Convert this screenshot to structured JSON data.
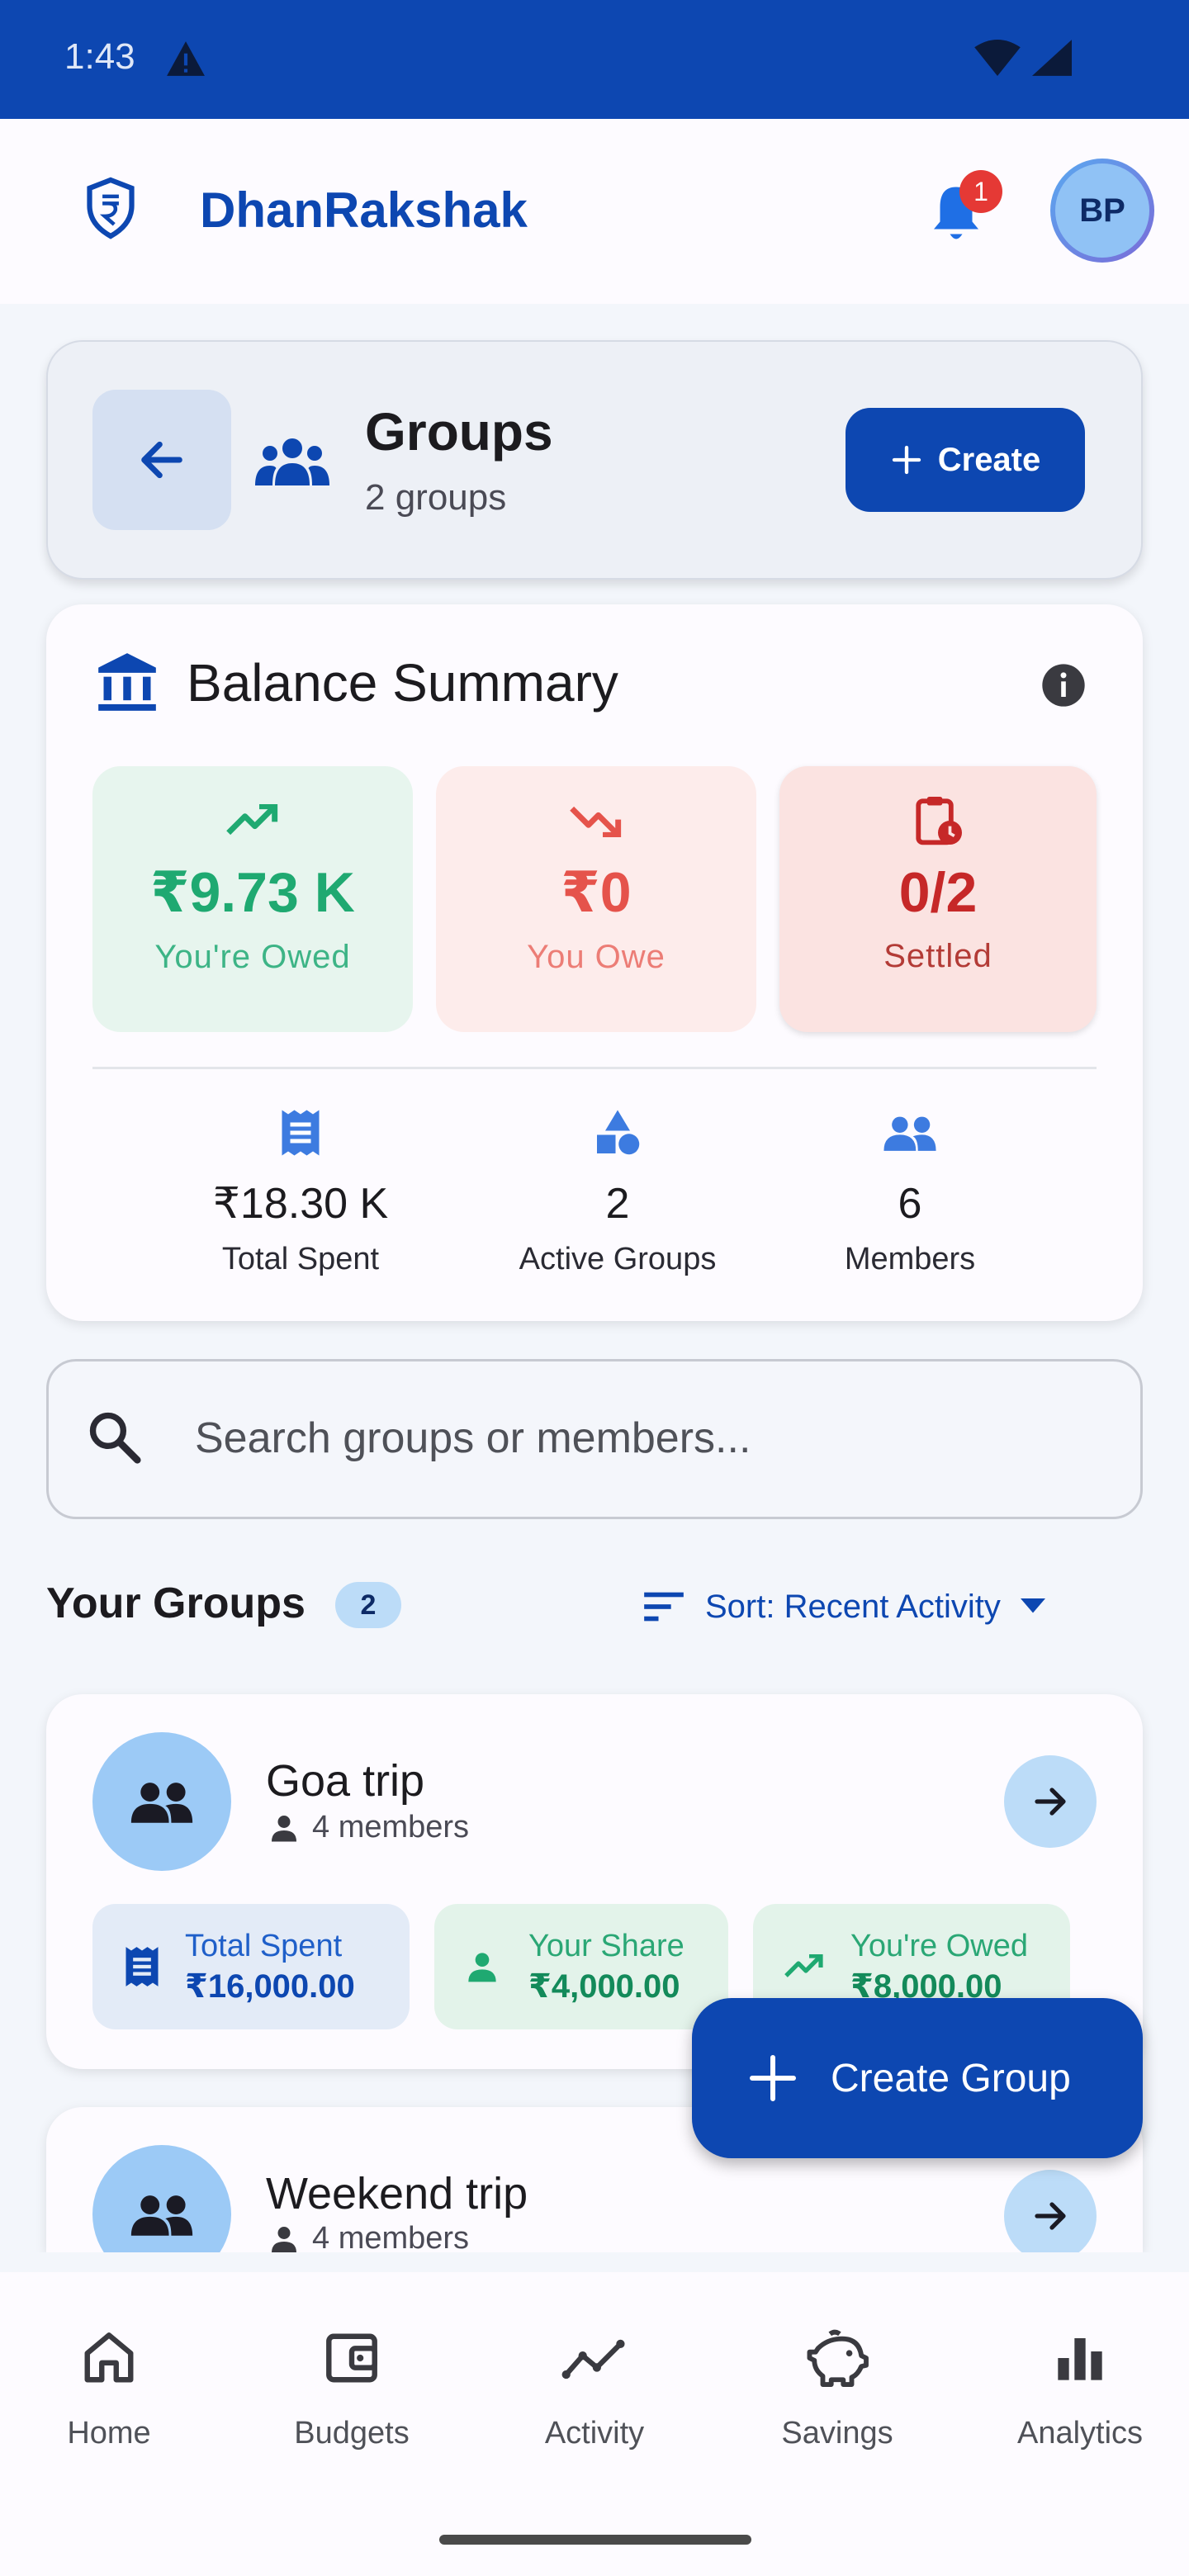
{
  "status_bar": {
    "time": "1:43"
  },
  "app_bar": {
    "title": "DhanRakshak",
    "notification_count": "1",
    "avatar_initials": "BP"
  },
  "header": {
    "title": "Groups",
    "subtitle": "2 groups",
    "create_label": "Create"
  },
  "balance_summary": {
    "title": "Balance Summary",
    "tiles": [
      {
        "value": "₹9.73 K",
        "label": "You're Owed",
        "color": "#1fa971"
      },
      {
        "value": "₹0",
        "label": "You Owe",
        "color": "#e5534b"
      },
      {
        "value": "0/2",
        "label": "Settled",
        "color": "#c62828"
      }
    ],
    "stats": [
      {
        "value": "₹18.30 K",
        "label": "Total Spent"
      },
      {
        "value": "2",
        "label": "Active Groups"
      },
      {
        "value": "6",
        "label": "Members"
      }
    ]
  },
  "search": {
    "placeholder": "Search groups or members..."
  },
  "groups_section": {
    "heading": "Your Groups",
    "count": "2",
    "sort_label": "Sort: Recent Activity",
    "groups": [
      {
        "name": "Goa trip",
        "members": "4 members",
        "chips": [
          {
            "label": "Total Spent",
            "value": "₹16,000.00"
          },
          {
            "label": "Your Share",
            "value": "₹4,000.00"
          },
          {
            "label": "You're Owed",
            "value": "₹8,000.00"
          }
        ]
      },
      {
        "name": "Weekend trip",
        "members": "4 members"
      }
    ]
  },
  "fab": {
    "label": "Create Group"
  },
  "bottom_nav": {
    "items": [
      {
        "label": "Home",
        "icon": "home-icon"
      },
      {
        "label": "Budgets",
        "icon": "wallet-icon"
      },
      {
        "label": "Activity",
        "icon": "activity-icon"
      },
      {
        "label": "Savings",
        "icon": "piggy-bank-icon"
      },
      {
        "label": "Analytics",
        "icon": "bar-chart-icon"
      }
    ]
  },
  "colors": {
    "primary": "#0d47b1",
    "positive": "#1fa971",
    "negative": "#e5534b",
    "accent": "#3d7be0"
  }
}
